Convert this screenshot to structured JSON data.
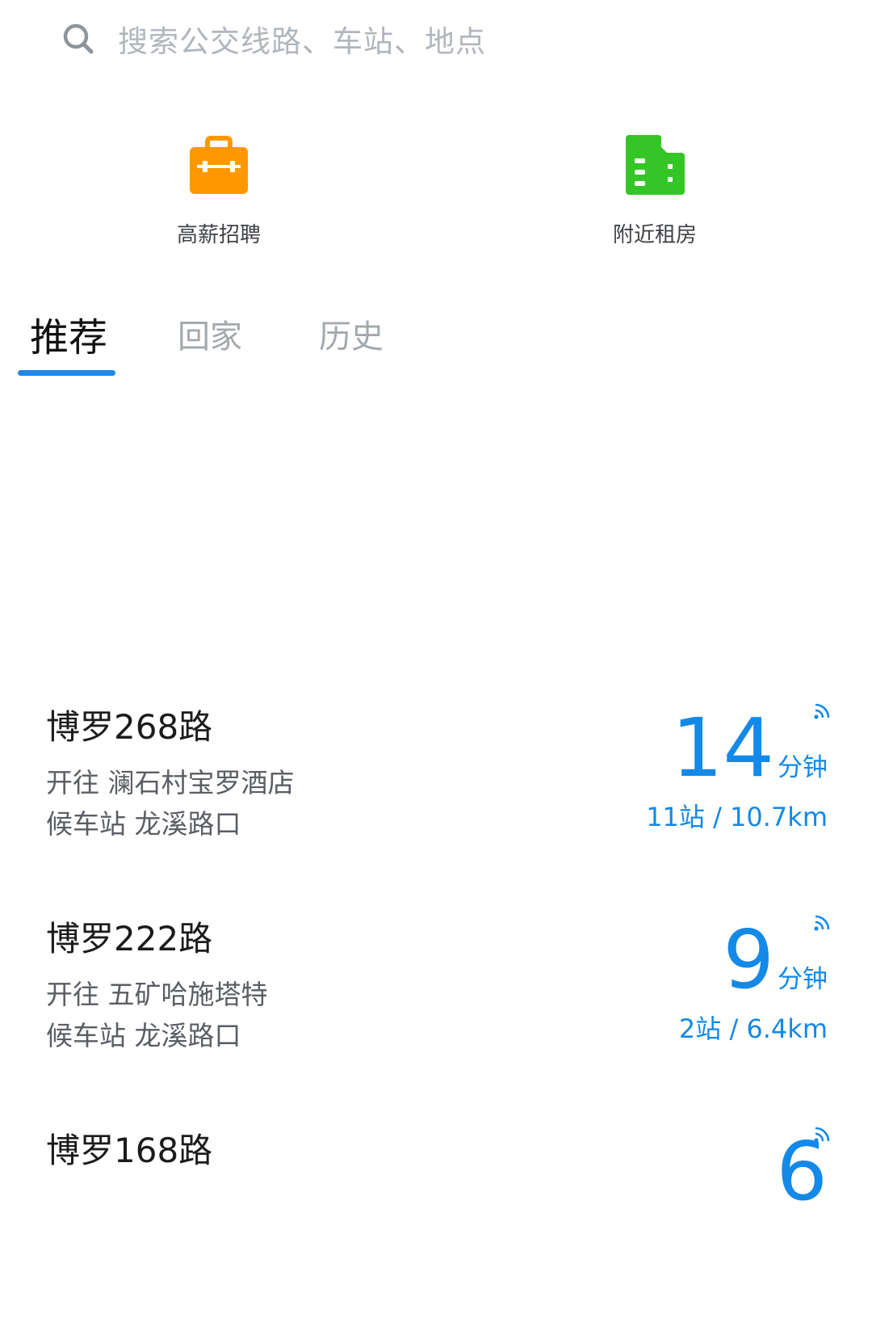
{
  "search": {
    "icon": "search-icon",
    "placeholder": "搜索公交线路、车站、地点"
  },
  "shortcuts": [
    {
      "label": "高薪招聘",
      "icon": "briefcase-icon",
      "color": "#FF9800"
    },
    {
      "label": "附近租房",
      "icon": "building-icon",
      "color": "#34C626"
    }
  ],
  "tabs": [
    {
      "label": "推荐",
      "active": true
    },
    {
      "label": "回家",
      "active": false
    },
    {
      "label": "历史",
      "active": false
    }
  ],
  "accent_color": "#1E88EC",
  "buses": [
    {
      "route": "博罗268路",
      "direction": "开往 澜石村宝罗酒店",
      "stop": "候车站 龙溪路口",
      "eta_number": "14",
      "eta_unit": "分钟",
      "distance": "11站 / 10.7km",
      "icon": "realtime-signal-icon"
    },
    {
      "route": "博罗222路",
      "direction": "开往 五矿哈施塔特",
      "stop": "候车站 龙溪路口",
      "eta_number": "9",
      "eta_unit": "分钟",
      "distance": "2站 / 6.4km",
      "icon": "realtime-signal-icon"
    },
    {
      "route": "博罗168路",
      "eta_number": "6",
      "icon": "realtime-signal-icon"
    }
  ]
}
